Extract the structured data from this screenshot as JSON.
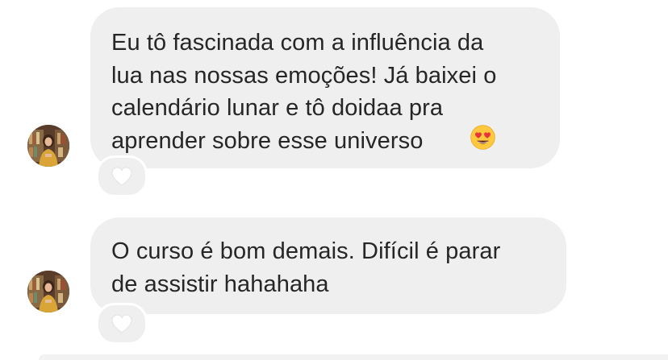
{
  "messages": [
    {
      "text": "Eu tô fascinada com a influência da\nlua nas nossas emoções! Já baixei o\ncalendário lunar e tô doidaa pra\naprender sobre esse universo",
      "emoji": "heart-eyes-emoji",
      "reaction_icon": "heart-outline-icon"
    },
    {
      "text": "O curso é bom demais. Difícil é parar\nde assistir hahahaha",
      "reaction_icon": "heart-outline-icon"
    }
  ],
  "colors": {
    "bubble": "#efefef",
    "text": "#262626",
    "background": "#ffffff",
    "heart": "#ffffff"
  }
}
